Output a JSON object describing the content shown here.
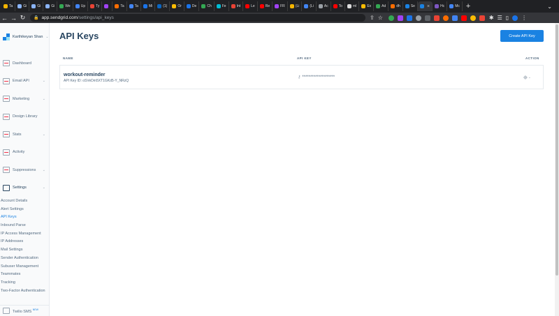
{
  "browser": {
    "tabs": [
      {
        "label": "Ta",
        "color": "#f4b400"
      },
      {
        "label": "Gi",
        "color": "#8ab4f8"
      },
      {
        "label": "Gi",
        "color": "#8ab4f8"
      },
      {
        "label": "Gi",
        "color": "#8ab4f8"
      },
      {
        "label": "We",
        "color": "#34a853"
      },
      {
        "label": "Up",
        "color": "#4285f4"
      },
      {
        "label": "Ty",
        "color": "#ea4335"
      },
      {
        "label": "",
        "color": "#a142f4"
      },
      {
        "label": "Ta",
        "color": "#ff6d00"
      },
      {
        "label": "Ta",
        "color": "#4285f4"
      },
      {
        "label": "Mi",
        "color": "#1a73e8"
      },
      {
        "label": "(1)",
        "color": "#0a66c2"
      },
      {
        "label": "Or",
        "color": "#fbbc04"
      },
      {
        "label": "De",
        "color": "#1a73e8"
      },
      {
        "label": "Ch",
        "color": "#34a853"
      },
      {
        "label": "Fe",
        "color": "#00bcd4"
      },
      {
        "label": "Int",
        "color": "#ea4335"
      },
      {
        "label": "Le",
        "color": "#ff0000"
      },
      {
        "label": "Re",
        "color": "#ff0000"
      },
      {
        "label": "FR",
        "color": "#a142f4"
      },
      {
        "label": "(Li",
        "color": "#f4b400"
      },
      {
        "label": "(Li",
        "color": "#4285f4"
      },
      {
        "label": "Ac",
        "color": "#9aa0a6"
      },
      {
        "label": "To",
        "color": "#ff0000"
      },
      {
        "label": "ml",
        "color": "#dcdcdc"
      },
      {
        "label": "Ex",
        "color": "#fbbc04"
      },
      {
        "label": "Ad",
        "color": "#34a853"
      },
      {
        "label": "dh",
        "color": "#ff6d00"
      },
      {
        "label": "Se",
        "color": "#1a82e2"
      },
      {
        "label": "",
        "color": "#1a82e2"
      },
      {
        "label": "Hc",
        "color": "#7e57c2"
      },
      {
        "label": "Mc",
        "color": "#4285f4"
      }
    ],
    "active_tab_index": 29,
    "url_domain": "app.sendgrid.com",
    "url_path": "/settings/api_keys",
    "extension_colors": [
      "#34a853",
      "#a142f4",
      "#1a73e8",
      "#9aa0a6",
      "#5f6368",
      "#ea4335",
      "#ff6d00",
      "#4285f4",
      "#ff0000",
      "#fbbc04",
      "#ea4335"
    ]
  },
  "sidebar": {
    "account_name": "Karthikeyan Shan",
    "items": [
      {
        "label": "Dashboard",
        "has_caret": false
      },
      {
        "label": "Email API",
        "has_caret": true
      },
      {
        "label": "Marketing",
        "has_caret": true
      },
      {
        "label": "Design Library",
        "has_caret": false
      },
      {
        "label": "Stats",
        "has_caret": true
      },
      {
        "label": "Activity",
        "has_caret": false
      },
      {
        "label": "Suppressions",
        "has_caret": true
      },
      {
        "label": "Settings",
        "has_caret": true
      }
    ],
    "settings_subitems": [
      "Account Details",
      "Alert Settings",
      "API Keys",
      "Inbound Parse",
      "IP Access Management",
      "IP Addresses",
      "Mail Settings",
      "Sender Authentication",
      "Subuser Management",
      "Teammates",
      "Tracking",
      "Two-Factor Authentication"
    ],
    "active_subitem": "API Keys",
    "footer_label": "Twilio SMS",
    "footer_badge": "NEW"
  },
  "main": {
    "title": "API Keys",
    "create_button": "Create API Key",
    "columns": {
      "name": "NAME",
      "api_key": "API KEY",
      "action": "ACTION"
    },
    "keys": [
      {
        "name": "workout-reminder",
        "id_line": "API Key ID: oSVeDm5XT1GKd5-Y_NRzQ",
        "masked": "********************"
      }
    ]
  },
  "colors": {
    "brand_blue": "#1a82e2",
    "navy_text": "#294661",
    "muted_text": "#546b81",
    "sidebar_bg": "#f9fafb"
  }
}
